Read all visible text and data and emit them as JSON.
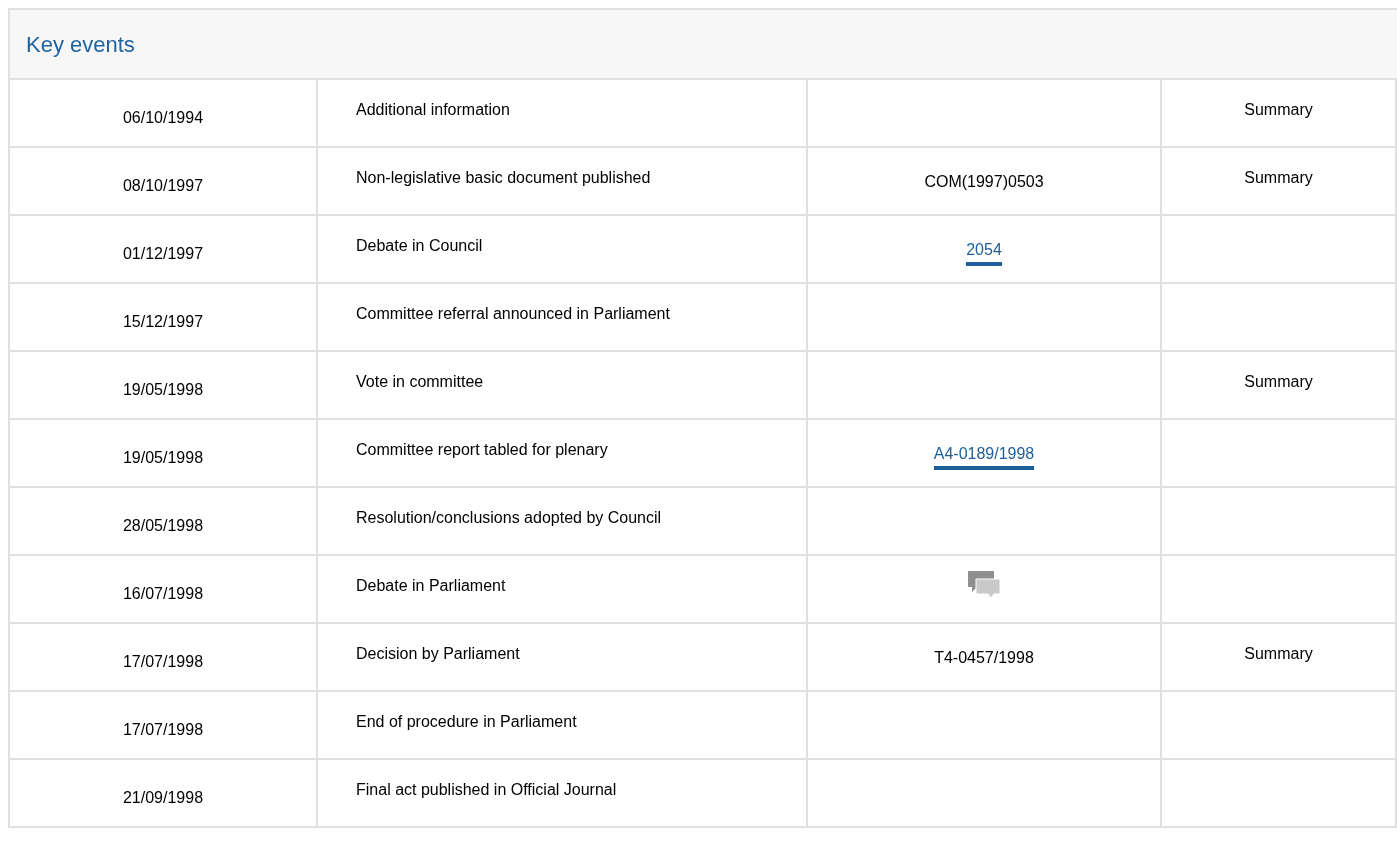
{
  "panel": {
    "title": "Key events"
  },
  "rows": [
    {
      "date": "06/10/1994",
      "event": "Additional information",
      "reference": null,
      "summary": "Summary"
    },
    {
      "date": "08/10/1997",
      "event": "Non-legislative basic document published",
      "reference": {
        "kind": "text",
        "text": "COM(1997)0503"
      },
      "summary": "Summary"
    },
    {
      "date": "01/12/1997",
      "event": "Debate in Council",
      "reference": {
        "kind": "link",
        "text": "2054"
      },
      "summary": null
    },
    {
      "date": "15/12/1997",
      "event": "Committee referral announced in Parliament",
      "reference": null,
      "summary": null
    },
    {
      "date": "19/05/1998",
      "event": "Vote in committee",
      "reference": null,
      "summary": "Summary"
    },
    {
      "date": "19/05/1998",
      "event": "Committee report tabled for plenary",
      "reference": {
        "kind": "link",
        "text": "A4-0189/1998"
      },
      "summary": null
    },
    {
      "date": "28/05/1998",
      "event": "Resolution/conclusions adopted by Council",
      "reference": null,
      "summary": null
    },
    {
      "date": "16/07/1998",
      "event": "Debate in Parliament",
      "reference": {
        "kind": "icon"
      },
      "summary": null
    },
    {
      "date": "17/07/1998",
      "event": "Decision by Parliament",
      "reference": {
        "kind": "text",
        "text": "T4-0457/1998"
      },
      "summary": "Summary"
    },
    {
      "date": "17/07/1998",
      "event": "End of procedure in Parliament",
      "reference": null,
      "summary": null
    },
    {
      "date": "21/09/1998",
      "event": "Final act published in Official Journal",
      "reference": null,
      "summary": null
    }
  ]
}
